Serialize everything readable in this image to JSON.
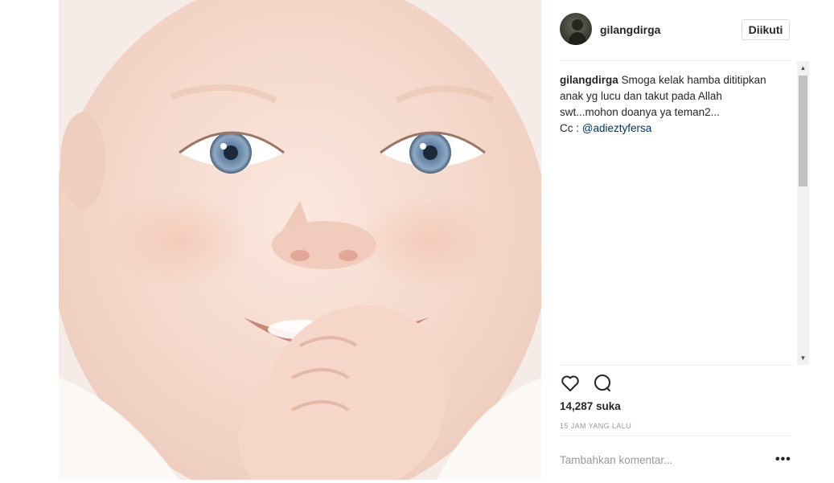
{
  "post": {
    "image_alt": "smiling baby photo",
    "author": {
      "username": "gilangdirga",
      "follow_label": "Diikuti"
    },
    "caption": {
      "author": "gilangdirga",
      "text": "Smoga kelak hamba dititipkan anak yg lucu dan takut pada Allah swt...mohon doanya ya teman2...",
      "cc_prefix": "Cc : ",
      "mention": "@adieztyfersa"
    },
    "actions": {
      "like_icon": "heart-icon",
      "comment_icon": "comment-icon"
    },
    "likes_label": "14,287 suka",
    "timestamp": "15 JAM YANG LALU",
    "comment_placeholder": "Tambahkan komentar...",
    "more_icon": "more-options-icon"
  },
  "colors": {
    "text_primary": "#262626",
    "text_secondary": "#999999",
    "mention": "#003569",
    "divider": "#efefef",
    "button_border": "#dbdbdb"
  }
}
